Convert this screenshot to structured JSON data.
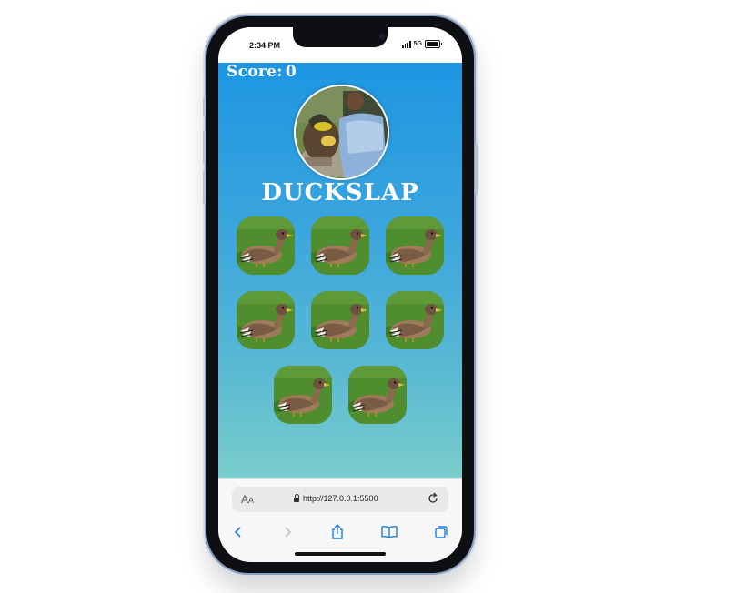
{
  "status_bar": {
    "time": "2:34 PM",
    "network": "5G",
    "icons": [
      "signal-icon",
      "battery-icon"
    ]
  },
  "game": {
    "score_label": "Score:",
    "score_value": "0",
    "title": "DUCKSLAP",
    "tiles": [
      {
        "image": "duck-image"
      },
      {
        "image": "duck-image"
      },
      {
        "image": "duck-image"
      },
      {
        "image": "duck-image"
      },
      {
        "image": "duck-image"
      },
      {
        "image": "duck-image"
      },
      {
        "image": "duck-image"
      },
      {
        "image": "duck-image"
      }
    ]
  },
  "browser": {
    "text_size_label": "AA",
    "url": "http://127.0.0.1:5500",
    "nav_icons": [
      "back-icon",
      "forward-icon",
      "share-icon",
      "bookmarks-icon",
      "tabs-icon"
    ]
  },
  "colors": {
    "gradient_top": "#1e96e2",
    "gradient_bottom": "#79cdcb",
    "link_blue": "#1a7fe0"
  }
}
